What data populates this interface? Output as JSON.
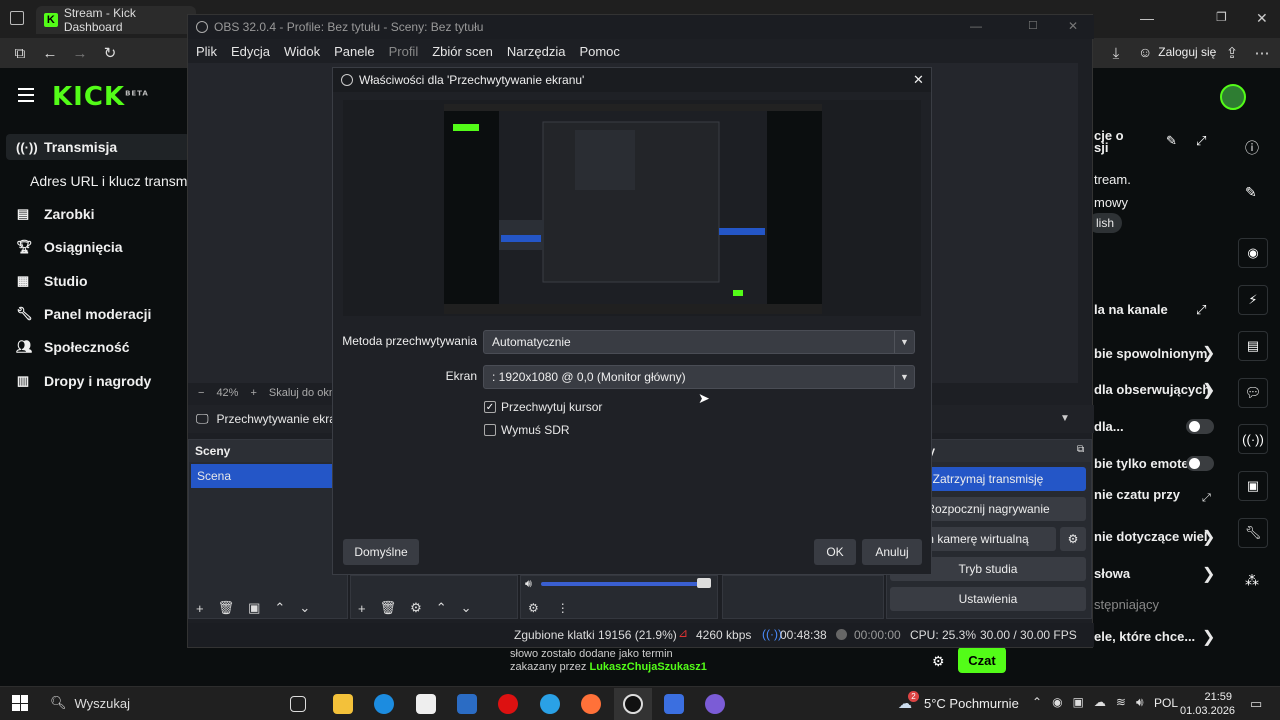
{
  "browser": {
    "tab_title": "Stream - Kick Dashboard",
    "login_label": "Zaloguj się"
  },
  "kick": {
    "logo": "KICK",
    "logo_badge": "BETA",
    "sidebar": [
      {
        "label": "Transmisja",
        "icon": "broadcast-icon"
      },
      {
        "label": "Adres URL i klucz transm",
        "icon": ""
      },
      {
        "label": "Zarobki",
        "icon": "earnings-icon"
      },
      {
        "label": "Osiągnięcia",
        "icon": "trophy-icon"
      },
      {
        "label": "Studio",
        "icon": "studio-icon"
      },
      {
        "label": "Panel moderacji",
        "icon": "wrench-icon"
      },
      {
        "label": "Społeczność",
        "icon": "community-icon"
      },
      {
        "label": "Dropy i nagrody",
        "icon": "drops-icon"
      }
    ],
    "right_texts": {
      "t1": "cje o",
      "t2": "sji",
      "t3": "tream.",
      "t4": "mowy",
      "t5": "lish",
      "t6": "la na kanale",
      "t7": "bie spowolnionym",
      "t8": "dla obserwujących",
      "t9": "dla...",
      "t10": "bie tylko emotek",
      "t11": "nie czatu przy",
      "t12": "nie dotyczące wiel",
      "t13": "słowa",
      "t14": "stępniający",
      "t15": "ele, które chce..."
    },
    "chat_line1": "słowo zostało dodane jako termin",
    "chat_line2_prefix": "zakazany przez ",
    "chat_user": "LukaszChujaSzukasz1",
    "chat_button": "Czat"
  },
  "obs": {
    "title": "OBS 32.0.4 - Profile: Bez tytułu - Sceny: Bez tytułu",
    "menu": [
      "Plik",
      "Edycja",
      "Widok",
      "Panele",
      "Profil",
      "Zbiór scen",
      "Narzędzia",
      "Pomoc"
    ],
    "zoom": "42%",
    "zoom_mode": "Skaluj do okna",
    "source_name": "Przechwytywanie ekranu",
    "scenes_header": "Sceny",
    "scene_item": "Scena",
    "controls_header": "erujący",
    "controls": [
      "Zatrzymaj transmisję",
      "Rozpocznij nagrywanie",
      "om kamerę wirtualną",
      "Tryb studia",
      "Ustawienia"
    ],
    "status": {
      "dropped": "Zgubione klatki 19156 (21.9%)",
      "bitrate": "4260 kbps",
      "stream_time": "00:48:38",
      "rec_time": "00:00:00",
      "cpu": "CPU: 25.3%",
      "fps": "30.00 / 30.00 FPS"
    }
  },
  "dialog": {
    "title": "Właściwości dla 'Przechwytywanie ekranu'",
    "method_label": "Metoda przechwytywania",
    "method_value": "Automatycznie",
    "screen_label": "Ekran",
    "screen_value": ": 1920x1080 @ 0,0 (Monitor główny)",
    "capture_cursor_label": "Przechwytuj kursor",
    "capture_cursor_checked": true,
    "force_sdr_label": "Wymuś SDR",
    "force_sdr_checked": false,
    "defaults_button": "Domyślne",
    "ok_button": "OK",
    "cancel_button": "Anuluj"
  },
  "taskbar": {
    "search_placeholder": "Wyszukaj",
    "weather": "5°C Pochmurnie",
    "weather_badge": "2",
    "language": "POL",
    "time": "21:59",
    "date": "01.03.2026"
  },
  "colors": {
    "kick_green": "#53fc18",
    "obs_accent": "#2456c7"
  }
}
